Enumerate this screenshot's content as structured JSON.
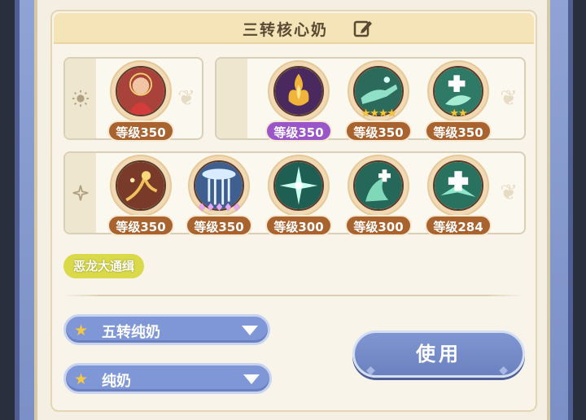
{
  "panel": {
    "title": "三转核心奶"
  },
  "row1_left": {
    "tab_icon": "sun-icon",
    "skills": [
      {
        "icon": "flame-lady-icon",
        "level": "等级350",
        "badge_color": "#a9632f",
        "stars": "",
        "star_color": ""
      }
    ]
  },
  "row1_right": {
    "tab_icon": "moon-icon",
    "skills": [
      {
        "icon": "golden-flame-icon",
        "level": "等级350",
        "badge_color": "#9a56c8",
        "stars": "",
        "star_color": ""
      },
      {
        "icon": "healing-hand-icon",
        "level": "等级350",
        "badge_color": "#a9632f",
        "stars": "★★★★",
        "star_color": "gold"
      },
      {
        "icon": "green-cross-icon",
        "level": "等级350",
        "badge_color": "#a9632f",
        "stars": "★★",
        "star_color": "gold"
      }
    ]
  },
  "row2": {
    "tab_icon": "sparkle-icon",
    "skills": [
      {
        "icon": "flower-vine-icon",
        "level": "等级350",
        "badge_color": "#a9632f",
        "stars": "",
        "star_color": ""
      },
      {
        "icon": "holy-rain-icon",
        "level": "等级350",
        "badge_color": "#a9632f",
        "stars": "♦♦♦♦♦",
        "star_color": "pink"
      },
      {
        "icon": "green-star-icon",
        "level": "等级300",
        "badge_color": "#a9632f",
        "stars": "",
        "star_color": ""
      },
      {
        "icon": "green-swirl-cross-icon",
        "level": "等级300",
        "badge_color": "#a9632f",
        "stars": "",
        "star_color": ""
      },
      {
        "icon": "green-burst-cross-icon",
        "level": "等级284",
        "badge_color": "#a9632f",
        "stars": "",
        "star_color": ""
      }
    ]
  },
  "tag": {
    "label": "恶龙大通缉"
  },
  "selects": [
    {
      "label": "五转纯奶"
    },
    {
      "label": "纯奶"
    }
  ],
  "use_button": {
    "label": "使用"
  }
}
